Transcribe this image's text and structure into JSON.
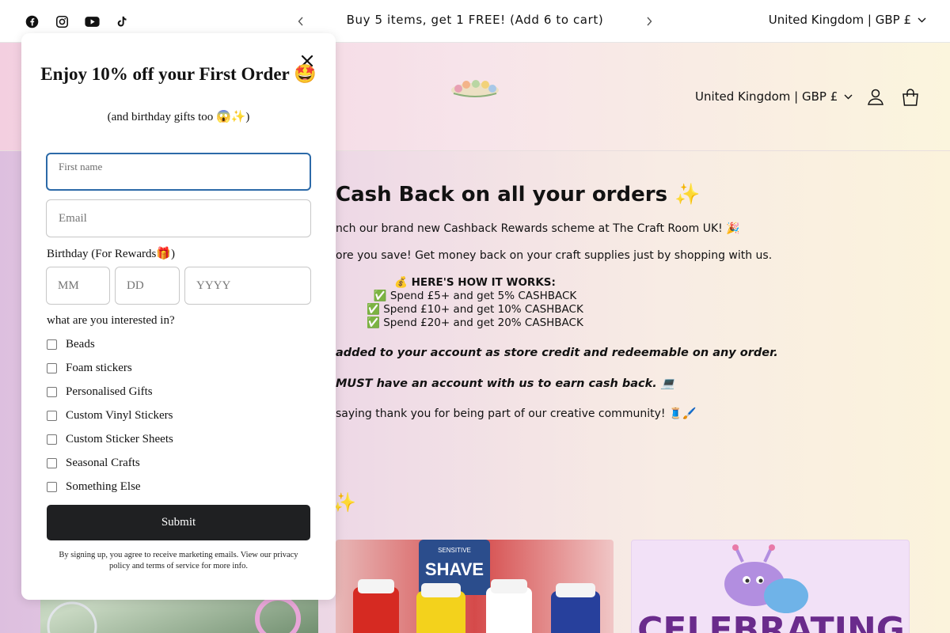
{
  "announcement": {
    "text": "Buy 5 items, get 1 FREE! (Add 6 to cart)",
    "country": "United Kingdom | GBP £"
  },
  "header": {
    "country": "United Kingdom | GBP £"
  },
  "cashback": {
    "title": "Cash Back on all your orders ✨",
    "p1": "nch our brand new Cashback Rewards scheme at The Craft Room UK! 🎉",
    "p2": "ore you save! Get money back on your craft supplies just by shopping with us.",
    "how_heading": "💰 HERE'S HOW IT WORKS:",
    "tiers": [
      "✅ Spend £5+ and get 5% CASHBACK",
      "✅ Spend £10+ and get 10% CASHBACK",
      "✅ Spend £20+ and get 20% CASHBACK"
    ],
    "b1": "added to your account as store credit and redeemable on any order.",
    "b2": "MUST have an account with us to earn cash back. 💻",
    "p3": " saying thank you for being part of our creative community! 🧵🖌️",
    "sparkle": "✨"
  },
  "cards": {
    "card3_text": "CELEBRATING"
  },
  "popup": {
    "title": "Enjoy 10% off your First Order 🤩",
    "subtitle": "(and birthday gifts too 😱✨)",
    "first_name_label": "First name",
    "email_placeholder": "Email",
    "birthday_label": "Birthday (For Rewards🎁)",
    "mm_placeholder": "MM",
    "dd_placeholder": "DD",
    "yyyy_placeholder": "YYYY",
    "interests_label": "what are you interested in?",
    "options": [
      "Beads",
      "Foam stickers",
      "Personalised Gifts",
      "Custom Vinyl Stickers",
      "Custom Sticker Sheets",
      "Seasonal Crafts",
      "Something Else"
    ],
    "submit_label": "Submit",
    "legal": "By signing up, you agree to receive marketing emails. View our privacy policy and terms of service for more info."
  }
}
